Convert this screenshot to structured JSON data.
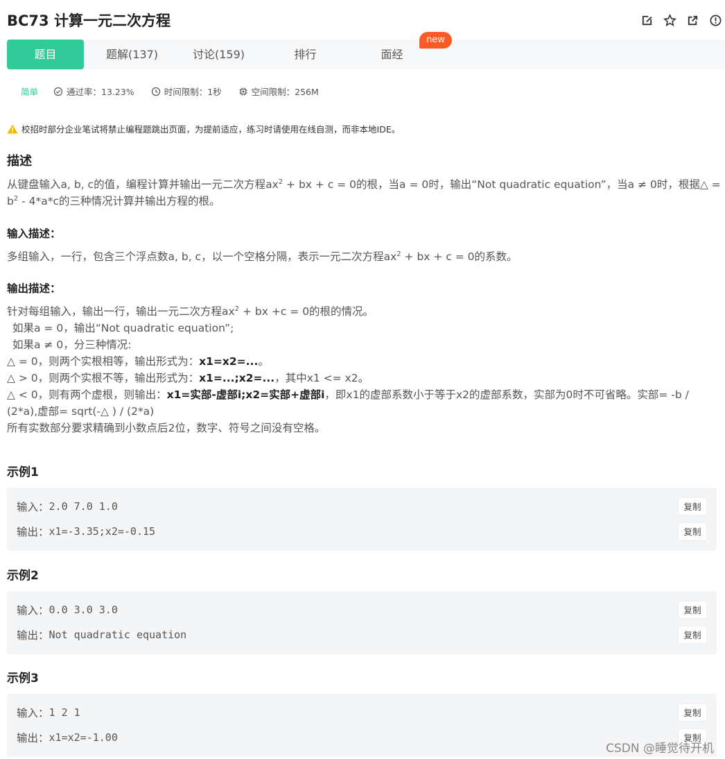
{
  "header": {
    "title": "BC73  计算一元二次方程",
    "icons": [
      "edit-icon",
      "star-icon",
      "share-icon",
      "info-icon"
    ]
  },
  "tabs": [
    {
      "label": "题目",
      "active": true
    },
    {
      "label": "题解(137)",
      "active": false
    },
    {
      "label": "讨论(159)",
      "active": false
    },
    {
      "label": "排行",
      "active": false
    },
    {
      "label": "面经",
      "active": false
    }
  ],
  "new_badge": "new",
  "meta": {
    "difficulty": "简单",
    "pass_rate": "通过率：13.23%",
    "time_limit": "时间限制：1秒",
    "memory_limit": "空间限制：256M"
  },
  "notice": "校招时部分企业笔试将禁止编程题跳出页面，为提前适应，练习时请使用在线自测，而非本地IDE。",
  "description": {
    "heading": "描述",
    "text_a": "从键盘输入a, b, c的值，编程计算并输出一元二次方程ax",
    "sup_a": "2",
    "text_b": " + bx + c = 0的根，当a = 0时，输出“Not quadratic equation”，当a ≠ 0时，根据△ = b",
    "sup_b": "2",
    "text_c": " - 4*a*c的三种情况计算并输出方程的根。"
  },
  "input_desc": {
    "heading": "输入描述：",
    "text_a": "多组输入，一行，包含三个浮点数a, b, c，以一个空格分隔，表示一元二次方程ax",
    "sup": "2",
    "text_b": " + bx + c = 0的系数。"
  },
  "output_desc": {
    "heading": "输出描述：",
    "line1_a": "针对每组输入，输出一行，输出一元二次方程ax",
    "line1_sup": "2",
    "line1_b": " + bx +c = 0的根的情况。",
    "line2": "如果a = 0，输出“Not quadratic equation”;",
    "line3": "如果a ≠  0，分三种情况:",
    "line4_a": "△ = 0，则两个实根相等，输出形式为：",
    "line4_b": "x1=x2=...",
    "line4_c": "。",
    "line5_a": "△  > 0，则两个实根不等，输出形式为：",
    "line5_b": "x1=...;x2=...",
    "line5_c": "，其中x1  <=  x2。",
    "line6_a": "△  < 0，则有两个虚根，则输出：",
    "line6_b": "x1=实部-虚部i;x2=实部+虚部i",
    "line6_c": "，即x1的虚部系数小于等于x2的虚部系数，实部为0时不可省略。实部= -b / (2*a),虚部= sqrt(-△ ) / (2*a)",
    "line7": "所有实数部分要求精确到小数点后2位，数字、符号之间没有空格。"
  },
  "examples": [
    {
      "title": "示例1",
      "input_label": "输入：",
      "input": "2.0 7.0 1.0",
      "output_label": "输出：",
      "output": "x1=-3.35;x2=-0.15",
      "copy": "复制"
    },
    {
      "title": "示例2",
      "input_label": "输入：",
      "input": "0.0 3.0 3.0",
      "output_label": "输出：",
      "output": "Not quadratic equation",
      "copy": "复制"
    },
    {
      "title": "示例3",
      "input_label": "输入：",
      "input": "1 2 1",
      "output_label": "输出：",
      "output": "x1=x2=-1.00",
      "copy": "复制"
    }
  ],
  "watermark": "CSDN @睡觉待开机",
  "colors": {
    "accent": "#32ca99",
    "badge": "#fe5a25",
    "warning": "#f5b800"
  }
}
